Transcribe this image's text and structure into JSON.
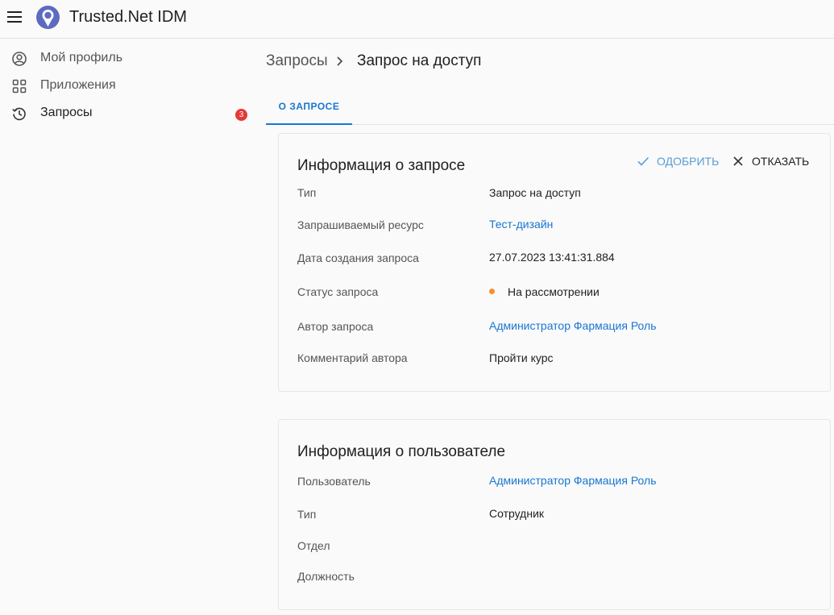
{
  "header": {
    "app_title": "Trusted.Net IDM"
  },
  "sidebar": {
    "items": [
      {
        "label": "Мой профиль",
        "icon": "user-circle-icon"
      },
      {
        "label": "Приложения",
        "icon": "apps-grid-icon"
      },
      {
        "label": "Запросы",
        "icon": "history-icon",
        "badge": "3"
      }
    ]
  },
  "breadcrumb": {
    "parent": "Запросы",
    "current": "Запрос на доступ"
  },
  "tabs": [
    {
      "label": "О ЗАПРОСЕ"
    }
  ],
  "request_info": {
    "title": "Информация о запросе",
    "approve_label": "ОДОБРИТЬ",
    "reject_label": "ОТКАЗАТЬ",
    "rows": [
      {
        "label": "Тип",
        "value": "Запрос на доступ"
      },
      {
        "label": "Запрашиваемый ресурс",
        "value": "Тест-дизайн"
      },
      {
        "label": "Дата создания запроса",
        "value": "27.07.2023 13:41:31.884"
      },
      {
        "label": "Статус запроса",
        "value": "На рассмотрении"
      },
      {
        "label": "Автор запроса",
        "value": "Администратор Фармация Роль"
      },
      {
        "label": "Комментарий автора",
        "value": "Пройти курс"
      }
    ]
  },
  "user_info": {
    "title": "Информация о пользователе",
    "rows": [
      {
        "label": "Пользователь",
        "value": "Администратор Фармация Роль"
      },
      {
        "label": "Тип",
        "value": "Сотрудник"
      },
      {
        "label": "Отдел",
        "value": ""
      },
      {
        "label": "Должность",
        "value": ""
      }
    ]
  },
  "colors": {
    "accent": "#1976d2",
    "approve": "#5b9bd5",
    "status_pending": "#f5902f",
    "badge": "#e53935",
    "logo": "#5c6bc0"
  }
}
